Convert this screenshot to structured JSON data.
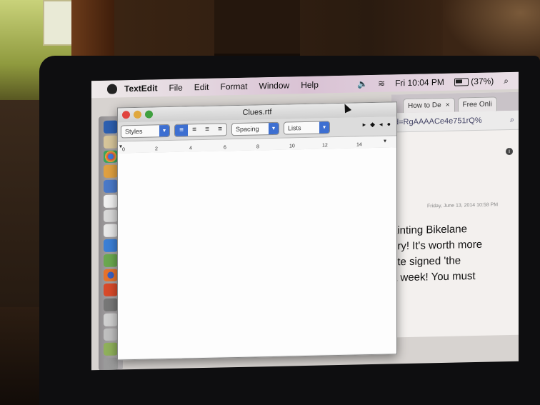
{
  "menubar": {
    "app_name": "TextEdit",
    "menus": [
      "File",
      "Edit",
      "Format",
      "Window",
      "Help"
    ],
    "clock": "Fri 10:04 PM",
    "battery": "(37%)"
  },
  "textedit": {
    "title": "Clues.rtf",
    "styles_label": "Styles",
    "spacing_label": "Spacing",
    "lists_label": "Lists",
    "ruler_numbers": [
      "0",
      "2",
      "4",
      "6",
      "8",
      "10",
      "12",
      "14"
    ]
  },
  "browser": {
    "tabs": [
      {
        "label": "How to De"
      },
      {
        "label": "Free Onli"
      }
    ],
    "url_fragment": "d=RgAAAACe4e751rQ%",
    "post_date": "Friday, June 13, 2014 10:58 PM",
    "post_lines": [
      "ainting Bikelane",
      "ery! It's worth more",
      "ote signed 'the",
      "a week! You must"
    ]
  },
  "colors": {
    "accent": "#3d6fd1",
    "close": "#e0443e",
    "minimize": "#e0a83e",
    "maximize": "#3fa03f"
  }
}
